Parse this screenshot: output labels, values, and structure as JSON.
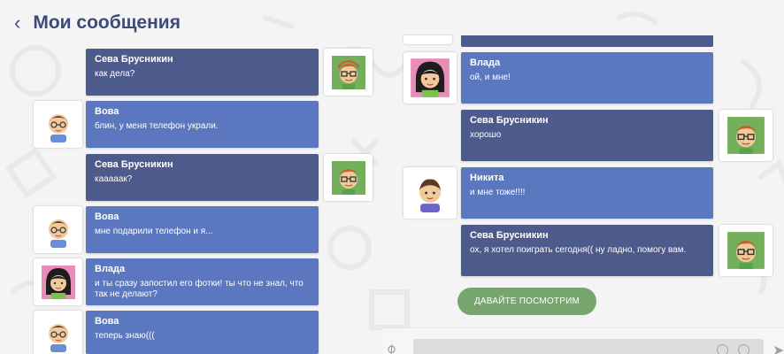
{
  "header": {
    "back_icon": "chevron-left-icon",
    "title": "Мои сообщения"
  },
  "left_messages": [
    {
      "sender": "Сева Брусникин",
      "text": "как дела?",
      "side": "me",
      "avatar": "seva"
    },
    {
      "sender": "Вова",
      "text": "блин, у меня телефон украли.",
      "side": "other",
      "avatar": "vova"
    },
    {
      "sender": "Сева Брусникин",
      "text": "каааaак?",
      "side": "me",
      "avatar": "seva"
    },
    {
      "sender": "Вова",
      "text": "мне подарили телефон и я...",
      "side": "other",
      "avatar": "vova"
    },
    {
      "sender": "Влада",
      "text": "и ты сразу запостил его фотки! ты что не знал, что так не делают?",
      "side": "other",
      "avatar": "vlada"
    },
    {
      "sender": "Вова",
      "text": "теперь знаю(((",
      "side": "other",
      "avatar": "vova"
    }
  ],
  "right_messages": [
    {
      "sender": "Влада",
      "text": "ой, и мне!",
      "side": "other",
      "avatar": "vlada"
    },
    {
      "sender": "Сева Брусникин",
      "text": "хорошо",
      "side": "me",
      "avatar": "seva"
    },
    {
      "sender": "Никита",
      "text": "и мне тоже!!!!",
      "side": "other",
      "avatar": "nikita"
    },
    {
      "sender": "Сева Брусникин",
      "text": "ох, я хотел поиграть сегодня(( ну ладно, помогу вам.",
      "side": "me",
      "avatar": "seva"
    }
  ],
  "action_button": {
    "label": "Давайте посмотрим"
  },
  "composer": {
    "attach_icon": "paperclip-icon",
    "emoji_icon": "emoji-icon",
    "sticker_icon": "sticker-icon",
    "send_icon": "send-icon"
  },
  "colors": {
    "title": "#3d4a78",
    "bubble_me": "#4d5a8c",
    "bubble_other": "#5b77bf",
    "action_button": "#77a56e"
  }
}
